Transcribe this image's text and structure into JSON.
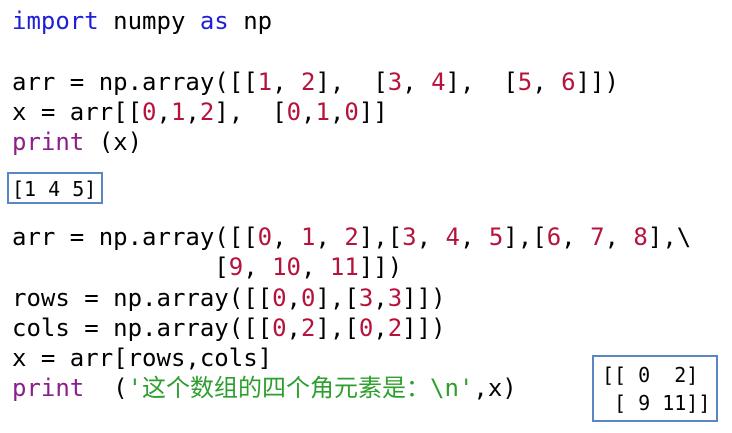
{
  "code": {
    "line1": {
      "kw_import": "import",
      "t1": " numpy ",
      "kw_as": "as",
      "t2": " np"
    },
    "line2": {
      "t1": "arr = np.array([[",
      "n1": "1",
      "t2": ", ",
      "n2": "2",
      "t3": "],  [",
      "n3": "3",
      "t4": ", ",
      "n4": "4",
      "t5": "],  [",
      "n5": "5",
      "t6": ", ",
      "n6": "6",
      "t7": "]])"
    },
    "line3": {
      "t1": "x = arr[[",
      "n1": "0",
      "t2": ",",
      "n2": "1",
      "t3": ",",
      "n3": "2",
      "t4": "],  [",
      "n4": "0",
      "t5": ",",
      "n5": "1",
      "t6": ",",
      "n6": "0",
      "t7": "]]"
    },
    "line4": {
      "bi_print": "print",
      "t1": " (x)"
    },
    "line5": {
      "t1": "arr = np.array([[",
      "n1": "0",
      "t2": ", ",
      "n2": "1",
      "t3": ", ",
      "n3": "2",
      "t4": "],[",
      "n4": "3",
      "t5": ", ",
      "n5": "4",
      "t6": ", ",
      "n6": "5",
      "t7": "],[",
      "n7": "6",
      "t8": ", ",
      "n8": "7",
      "t9": ", ",
      "n9": "8",
      "t10": "],\\"
    },
    "line6": {
      "t1": "              [",
      "n1": "9",
      "t2": ", ",
      "n2": "10",
      "t3": ", ",
      "n3": "11",
      "t4": "]])"
    },
    "line7": {
      "t1": "rows = np.array([[",
      "n1": "0",
      "t2": ",",
      "n2": "0",
      "t3": "],[",
      "n3": "3",
      "t4": ",",
      "n4": "3",
      "t5": "]])"
    },
    "line8": {
      "t1": "cols = np.array([[",
      "n1": "0",
      "t2": ",",
      "n2": "2",
      "t3": "],[",
      "n3": "0",
      "t4": ",",
      "n4": "2",
      "t5": "]])"
    },
    "line9": {
      "t1": "x = arr[rows,cols]"
    },
    "line10": {
      "bi_print": "print",
      "t1": "  (",
      "str": "'这个数组的四个角元素是：\\n'",
      "t2": ",x)"
    }
  },
  "output1": "[1 4 5]",
  "output2": {
    "row1": "[[ 0  2]",
    "row2": " [ 9 11]]"
  },
  "colors": {
    "keyword": "#1f1fd6",
    "builtin": "#8b1f8b",
    "number": "#b5133c",
    "string": "#2e9f2e",
    "box_border": "#5a86c6"
  }
}
